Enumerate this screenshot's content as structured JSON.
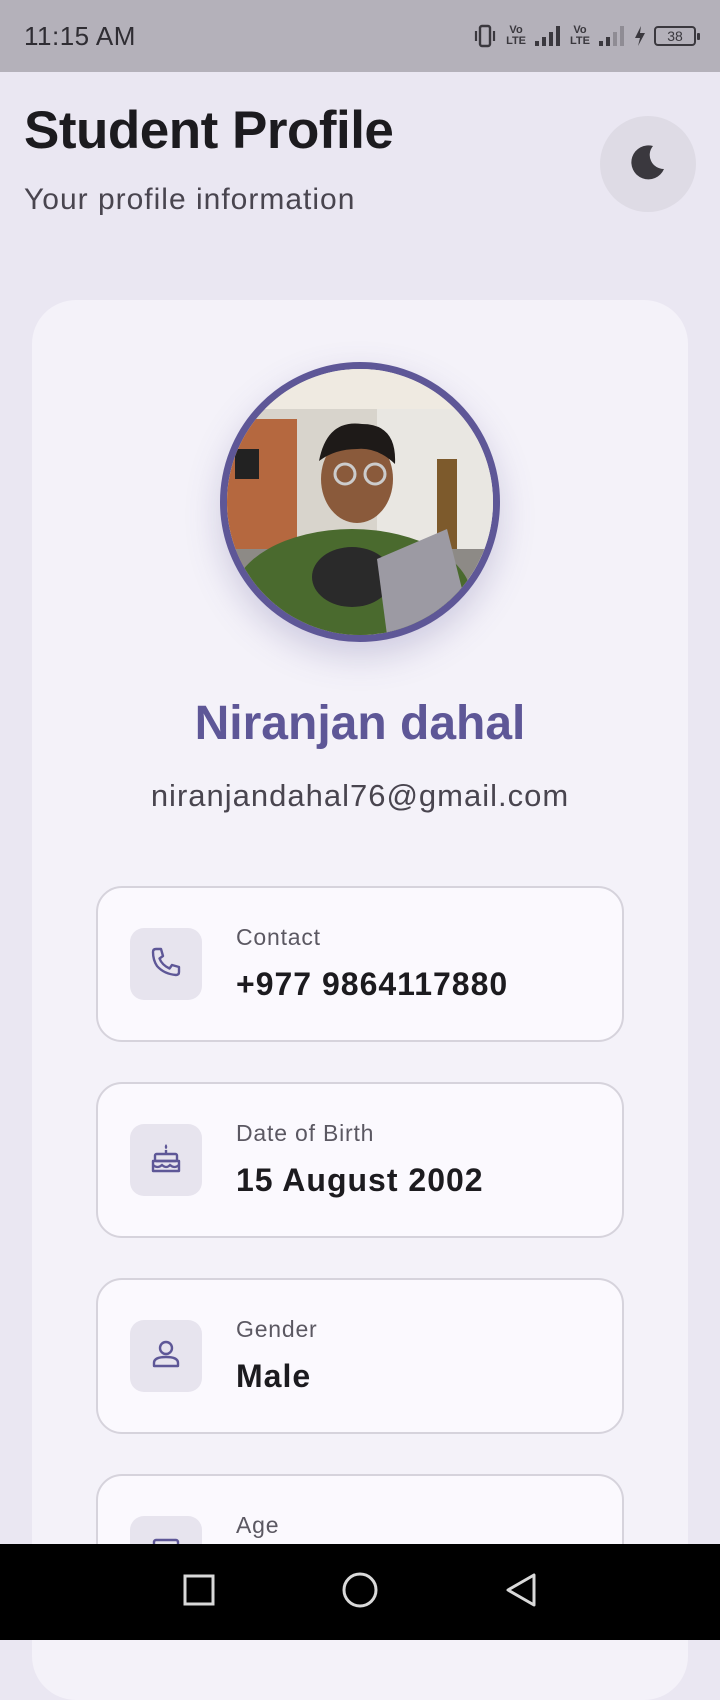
{
  "status_bar": {
    "time": "11:15 AM",
    "sim1_label_top": "Vo",
    "sim1_label_bottom": "LTE",
    "sim2_label_top": "Vo",
    "sim2_label_bottom": "LTE",
    "battery_level": "38",
    "icons": [
      "vibrate-icon",
      "signal-icon",
      "signal-icon",
      "charging-icon",
      "battery-icon"
    ]
  },
  "header": {
    "title": "Student Profile",
    "subtitle": "Your profile information",
    "theme_toggle_icon": "moon-icon"
  },
  "profile": {
    "name": "Niranjan dahal",
    "email": "niranjandahal76@gmail.com",
    "avatar_ring_color": "#5e5797",
    "details": [
      {
        "label": "Contact",
        "value": "+977 9864117880",
        "icon": "phone-icon"
      },
      {
        "label": "Date of Birth",
        "value": "15 August 2002",
        "icon": "cake-icon"
      },
      {
        "label": "Gender",
        "value": "Male",
        "icon": "person-icon"
      },
      {
        "label": "Age",
        "value": "",
        "icon": "calendar-icon"
      }
    ]
  },
  "colors": {
    "accent": "#5e5797",
    "background": "#eae7f2",
    "card": "#f4f2f9"
  },
  "nav_bar": {
    "icons": [
      "recent-apps-icon",
      "home-icon",
      "back-icon"
    ]
  }
}
